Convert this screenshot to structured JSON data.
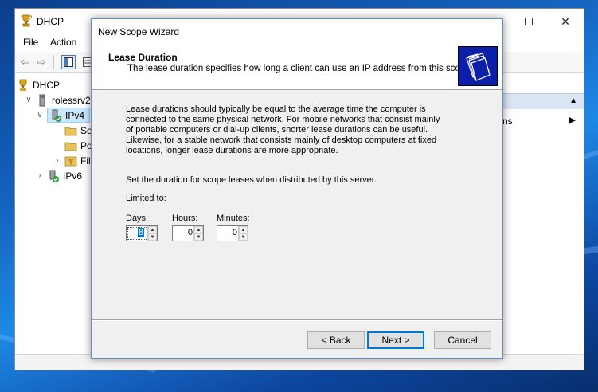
{
  "dhcp_window": {
    "title": "DHCP",
    "menu": [
      "File",
      "Action"
    ],
    "tree": {
      "root": "DHCP",
      "server": "rolessrv2.",
      "ipv4": "IPv4",
      "ipv4_children": [
        "Se",
        "Po",
        "Fil"
      ],
      "ipv6": "IPv6"
    },
    "actions_item": "ns"
  },
  "wizard": {
    "title": "New Scope Wizard",
    "header_title": "Lease Duration",
    "header_subtitle": "The lease duration specifies how long a client can use an IP address from this scope.",
    "body_paragraph": "Lease durations should typically be equal to the average time the computer is connected to the same physical network. For mobile networks that consist mainly of portable computers or dial-up clients, shorter lease durations can be useful. Likewise, for a stable network that consists mainly of desktop computers at fixed locations, longer lease durations are more appropriate.",
    "set_duration_text": "Set the duration for scope leases when distributed by this server.",
    "limited_to_label": "Limited to:",
    "fields": {
      "days_label": "Days:",
      "days_value": "8",
      "hours_label": "Hours:",
      "hours_value": "0",
      "minutes_label": "Minutes:",
      "minutes_value": "0"
    },
    "buttons": {
      "back": "< Back",
      "next": "Next >",
      "cancel": "Cancel"
    }
  }
}
